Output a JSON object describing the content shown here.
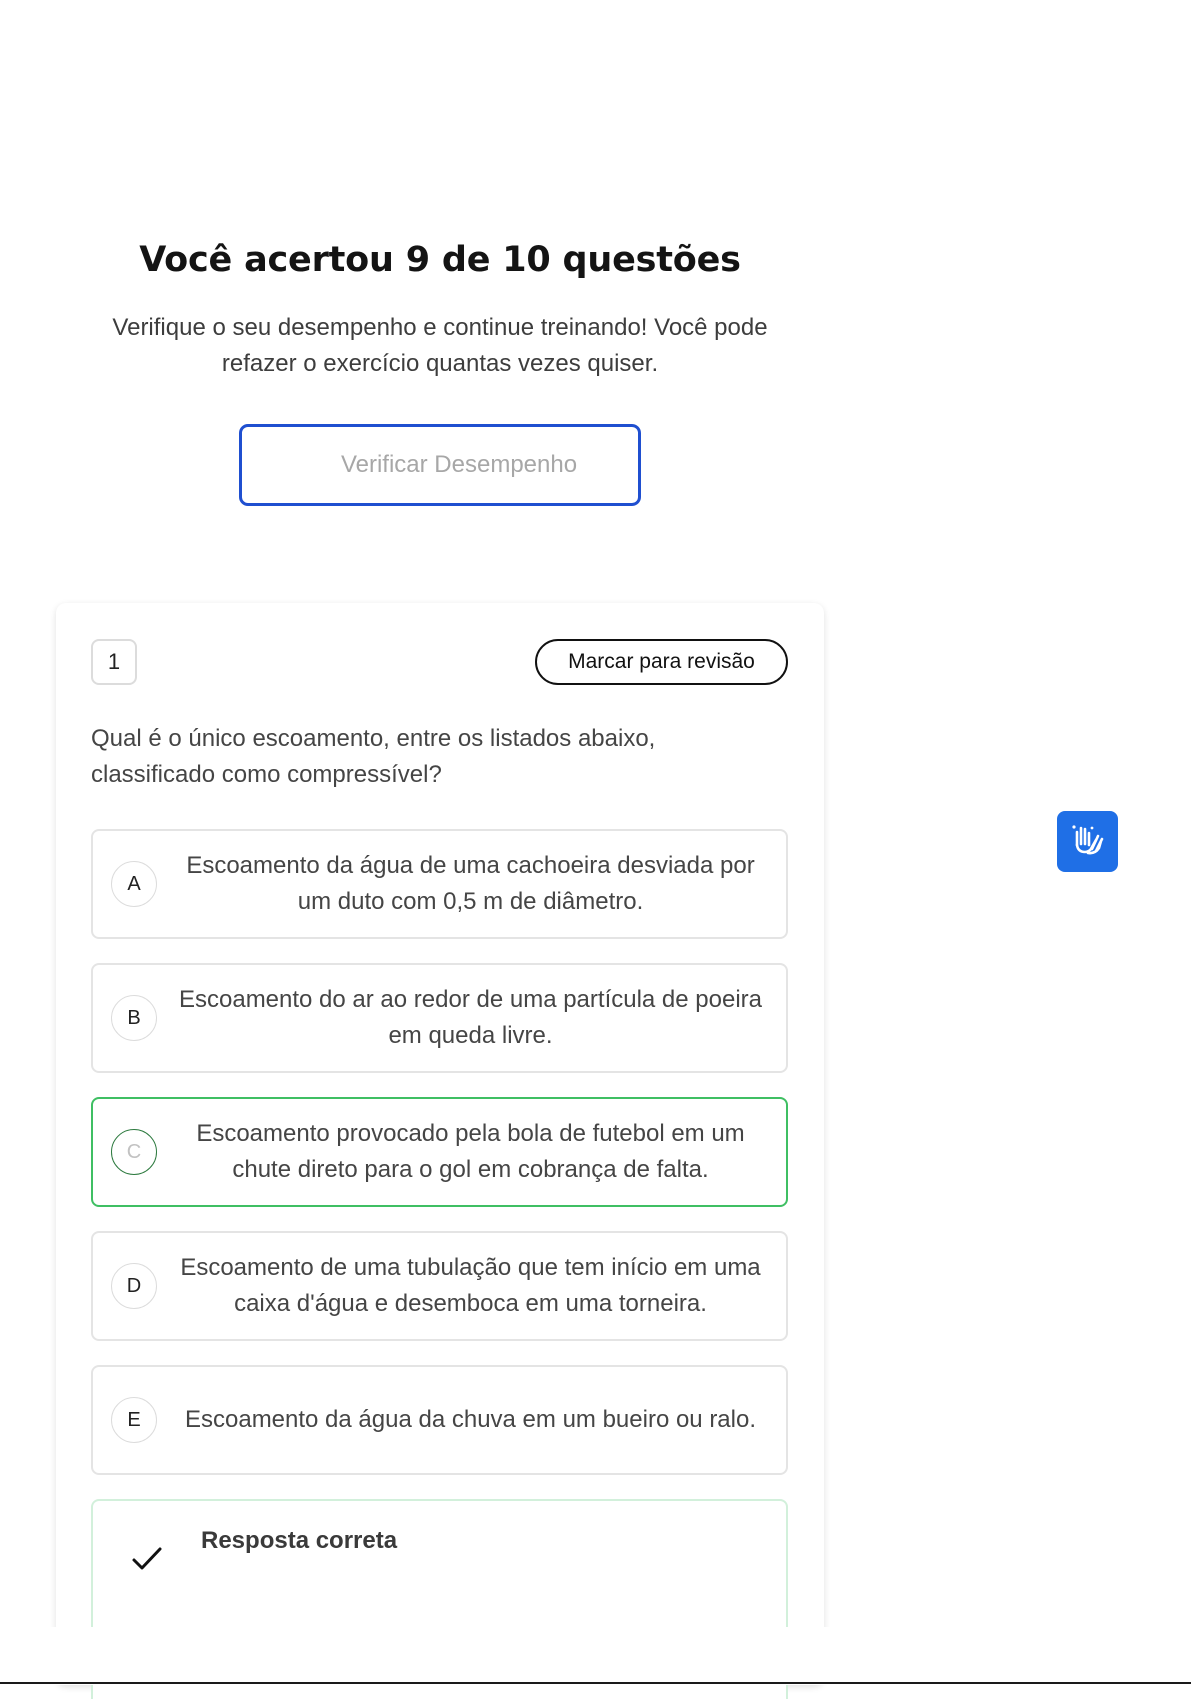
{
  "summary": {
    "title": "Você acertou 9 de 10 questões",
    "subtitle": "Verifique o seu desempenho e continue treinando! Você pode refazer o exercício quantas vezes quiser.",
    "verify_button": "Verificar Desempenho"
  },
  "question": {
    "number": "1",
    "review_button": "Marcar para revisão",
    "text": "Qual é o único escoamento, entre os listados abaixo, classificado como compressível?",
    "options": [
      {
        "letter": "A",
        "text": "Escoamento da água de uma cachoeira desviada por um duto com 0,5 m de diâmetro."
      },
      {
        "letter": "B",
        "text": "Escoamento do ar ao redor de uma partícula de poeira em queda livre."
      },
      {
        "letter": "C",
        "text": "Escoamento provocado pela bola de futebol em um chute direto para o gol em cobrança de falta."
      },
      {
        "letter": "D",
        "text": "Escoamento de uma tubulação que tem início em uma caixa d'água e desemboca em uma torneira."
      },
      {
        "letter": "E",
        "text": "Escoamento da água da chuva em um bueiro ou ralo."
      }
    ],
    "selected_option": "C",
    "feedback_title": "Resposta correta"
  },
  "icons": {
    "check": "check-icon",
    "accessibility": "sign-language-hands-icon"
  },
  "colors": {
    "accent_blue": "#1f4fd0",
    "correct_green": "#3fbf63",
    "a11y_blue": "#1f6fe6"
  }
}
